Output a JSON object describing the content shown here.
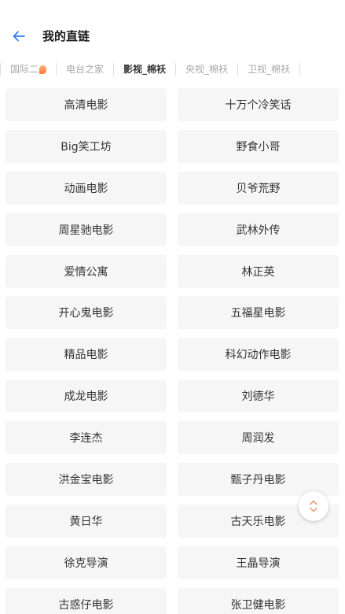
{
  "header": {
    "title": "我的直链",
    "back_icon": "arrow-left-icon",
    "accent_color": "#2f7cf6"
  },
  "tabs": [
    {
      "label": "国际二",
      "badge": true,
      "active": false
    },
    {
      "label": "电台之家",
      "badge": false,
      "active": false
    },
    {
      "label": "影视_棉袄",
      "badge": false,
      "active": true
    },
    {
      "label": "央视_棉袄",
      "badge": false,
      "active": false
    },
    {
      "label": "卫视_棉袄",
      "badge": false,
      "active": false
    }
  ],
  "items": [
    "高清电影",
    "十万个冷笑话",
    "Big笑工坊",
    "野食小哥",
    "动画电影",
    "贝爷荒野",
    "周星驰电影",
    "武林外传",
    "爱情公寓",
    "林正英",
    "开心鬼电影",
    "五福星电影",
    "精品电影",
    "科幻动作电影",
    "成龙电影",
    "刘德华",
    "李连杰",
    "周润发",
    "洪金宝电影",
    "甄子丹电影",
    "黄日华",
    "古天乐电影",
    "徐克导演",
    "王晶导演",
    "古惑仔电影",
    "张卫健电影"
  ],
  "floating": {
    "scroll_icon": "chevron-up-down-icon",
    "accent_color": "#f0a080"
  }
}
